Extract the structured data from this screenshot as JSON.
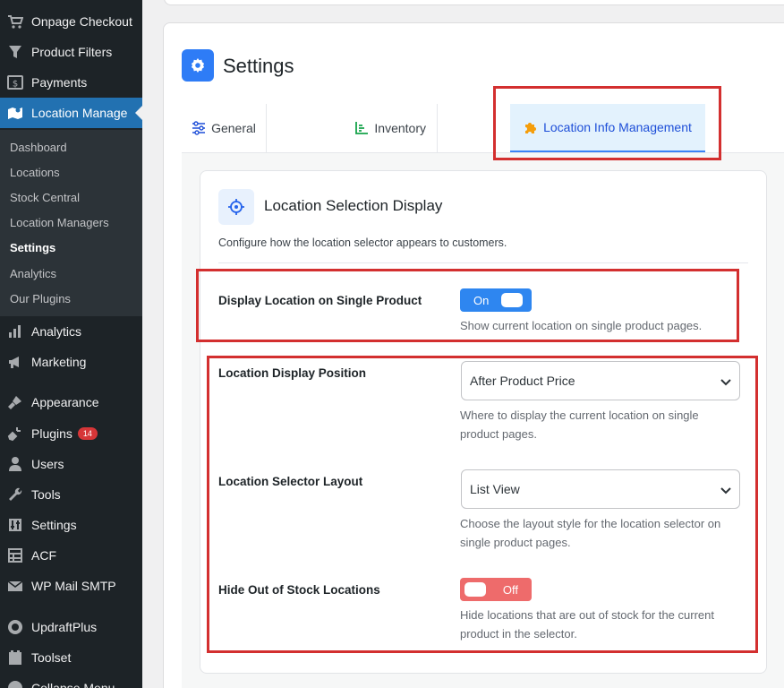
{
  "sidebar": {
    "top_items": [
      {
        "label": "Onpage Checkout",
        "icon": "cart-icon"
      },
      {
        "label": "Product Filters",
        "icon": "filter-icon"
      },
      {
        "label": "Payments",
        "icon": "dollar-icon"
      },
      {
        "label": "Location Manage",
        "icon": "map-icon"
      }
    ],
    "submenu": [
      "Dashboard",
      "Locations",
      "Stock Central",
      "Location Managers",
      "Settings",
      "Analytics",
      "Our Plugins"
    ],
    "bottom_items": [
      {
        "label": "Analytics",
        "icon": "bar-chart-icon"
      },
      {
        "label": "Marketing",
        "icon": "megaphone-icon"
      },
      {
        "label": "Appearance",
        "icon": "brush-icon"
      },
      {
        "label": "Plugins",
        "icon": "plug-icon",
        "badge": "14"
      },
      {
        "label": "Users",
        "icon": "user-icon"
      },
      {
        "label": "Tools",
        "icon": "wrench-icon"
      },
      {
        "label": "Settings",
        "icon": "sliders-icon"
      },
      {
        "label": "ACF",
        "icon": "table-icon"
      },
      {
        "label": "WP Mail SMTP",
        "icon": "mail-icon"
      },
      {
        "label": "UpdraftPlus",
        "icon": "updraft-icon"
      },
      {
        "label": "Toolset",
        "icon": "toolset-icon"
      },
      {
        "label": "Collapse Menu",
        "icon": "collapse-icon"
      }
    ]
  },
  "page": {
    "title": "Settings"
  },
  "tabs": [
    {
      "label": "General",
      "icon": "sliders-icon"
    },
    {
      "label": "Inventory",
      "icon": "chart-icon"
    },
    {
      "label": "Location Info Management",
      "icon": "puzzle-icon"
    }
  ],
  "card": {
    "title": "Location Selection Display",
    "description": "Configure how the location selector appears to customers.",
    "rows": {
      "display_location": {
        "label": "Display Location on Single Product",
        "toggle": "On",
        "help": "Show current location on single product pages."
      },
      "display_position": {
        "label": "Location Display Position",
        "value": "After Product Price",
        "help": "Where to display the current location on single product pages."
      },
      "selector_layout": {
        "label": "Location Selector Layout",
        "value": "List View",
        "help": "Choose the layout style for the location selector on single product pages."
      },
      "hide_out_of_stock": {
        "label": "Hide Out of Stock Locations",
        "toggle": "Off",
        "help": "Hide locations that are out of stock for the current product in the selector."
      }
    }
  },
  "colors": {
    "sidebar_bg": "#1d2327",
    "active_blue": "#2271b1",
    "toggle_on": "#2e86f0",
    "toggle_off": "#ee6b6b",
    "highlight_red": "#d32f2f"
  }
}
